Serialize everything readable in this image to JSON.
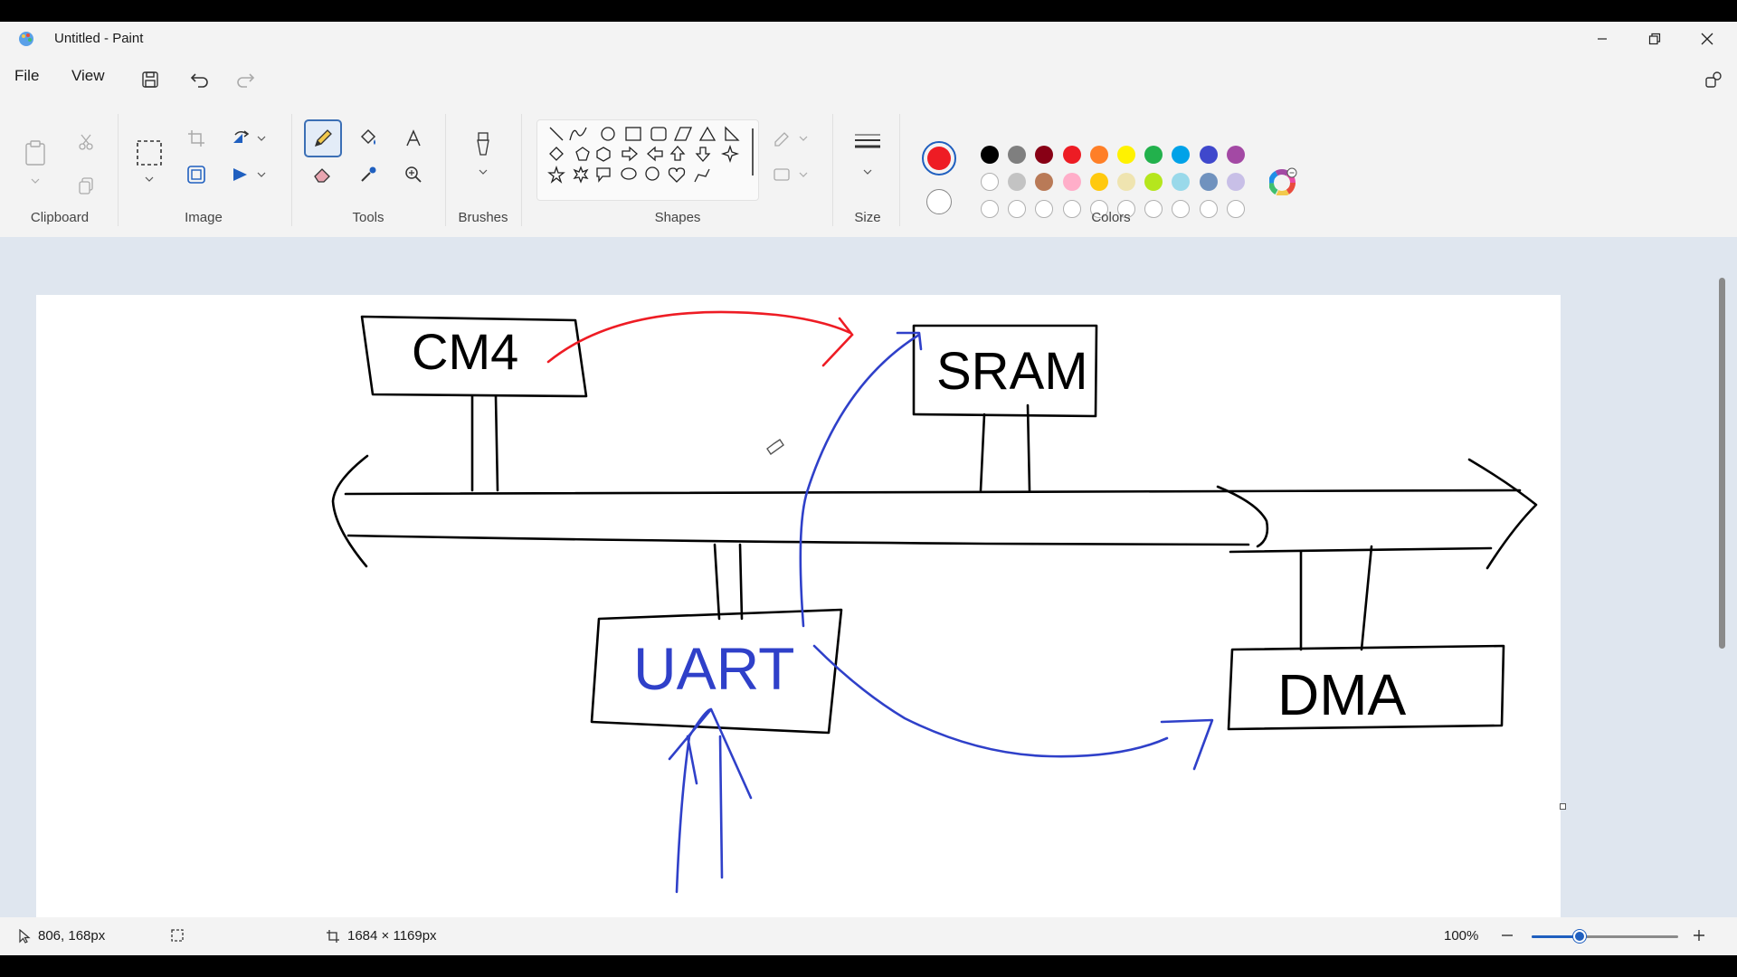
{
  "window": {
    "title": "Untitled - Paint"
  },
  "menu": {
    "file": "File",
    "view": "View"
  },
  "ribbon": {
    "groups": {
      "clipboard": "Clipboard",
      "image": "Image",
      "tools": "Tools",
      "brushes": "Brushes",
      "shapes": "Shapes",
      "size": "Size",
      "colors": "Colors"
    },
    "primary_color": "#ee1c24",
    "secondary_color": "#ffffff",
    "palette_row1": [
      "#000000",
      "#7f7f7f",
      "#880015",
      "#ed1c24",
      "#ff7f27",
      "#fff200",
      "#22b14c",
      "#00a2e8",
      "#3f48cc",
      "#a349a4"
    ],
    "palette_row2": [
      "#ffffff",
      "#c3c3c3",
      "#b97a57",
      "#ffaec9",
      "#ffc90e",
      "#efe4b0",
      "#b5e61d",
      "#99d9ea",
      "#7092be",
      "#c8bfe7"
    ]
  },
  "canvas": {
    "labels": {
      "cm4": "CM4",
      "sram": "SRAM",
      "uart": "UART",
      "dma": "DMA"
    }
  },
  "status": {
    "cursor_position": "806, 168px",
    "canvas_size": "1684 × 1169px",
    "zoom_level": "100%",
    "zoom_fraction": 0.33
  }
}
